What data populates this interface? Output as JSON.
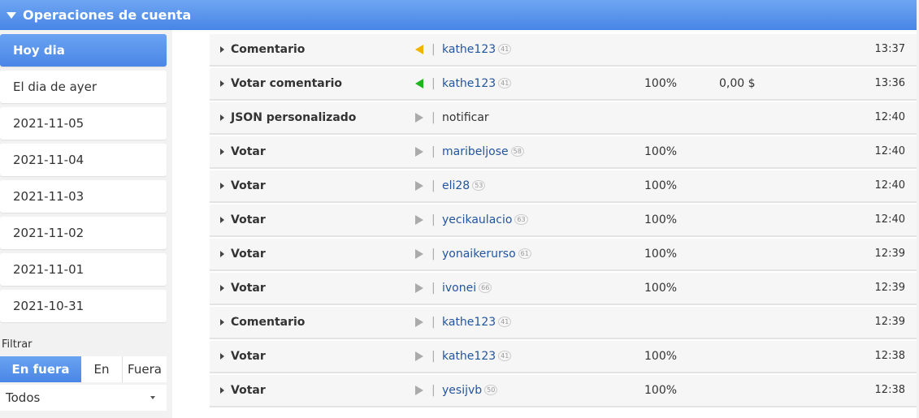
{
  "header": {
    "title": "Operaciones de cuenta"
  },
  "days": [
    "Hoy dia",
    "El dia de ayer",
    "2021-11-05",
    "2021-11-04",
    "2021-11-03",
    "2021-11-02",
    "2021-11-01",
    "2021-10-31"
  ],
  "filter": {
    "label": "Filtrar",
    "segments": [
      "En fuera",
      "En",
      "Fuera"
    ],
    "select_value": "Todos"
  },
  "operations": [
    {
      "op": "Comentario",
      "dir": "left-amber",
      "account": "kathe123",
      "rep": "41",
      "pct": "",
      "amount": "",
      "time": "13:37"
    },
    {
      "op": "Votar comentario",
      "dir": "left-green",
      "account": "kathe123",
      "rep": "41",
      "pct": "100%",
      "amount": "0,00 $",
      "time": "13:36"
    },
    {
      "op": "JSON personalizado",
      "dir": "right-gray",
      "account": "notificar",
      "rep": "",
      "pct": "",
      "amount": "",
      "time": "12:40"
    },
    {
      "op": "Votar",
      "dir": "right-gray",
      "account": "maribeljose",
      "rep": "58",
      "pct": "100%",
      "amount": "",
      "time": "12:40"
    },
    {
      "op": "Votar",
      "dir": "right-gray",
      "account": "eli28",
      "rep": "53",
      "pct": "100%",
      "amount": "",
      "time": "12:40"
    },
    {
      "op": "Votar",
      "dir": "right-gray",
      "account": "yecikaulacio",
      "rep": "63",
      "pct": "100%",
      "amount": "",
      "time": "12:40"
    },
    {
      "op": "Votar",
      "dir": "right-gray",
      "account": "yonaikerurso",
      "rep": "61",
      "pct": "100%",
      "amount": "",
      "time": "12:39"
    },
    {
      "op": "Votar",
      "dir": "right-gray",
      "account": "ivonei",
      "rep": "66",
      "pct": "100%",
      "amount": "",
      "time": "12:39"
    },
    {
      "op": "Comentario",
      "dir": "right-gray",
      "account": "kathe123",
      "rep": "41",
      "pct": "",
      "amount": "",
      "time": "12:39"
    },
    {
      "op": "Votar",
      "dir": "right-gray",
      "account": "kathe123",
      "rep": "41",
      "pct": "100%",
      "amount": "",
      "time": "12:38"
    },
    {
      "op": "Votar",
      "dir": "right-gray",
      "account": "yesijvb",
      "rep": "50",
      "pct": "100%",
      "amount": "",
      "time": "12:38"
    }
  ]
}
